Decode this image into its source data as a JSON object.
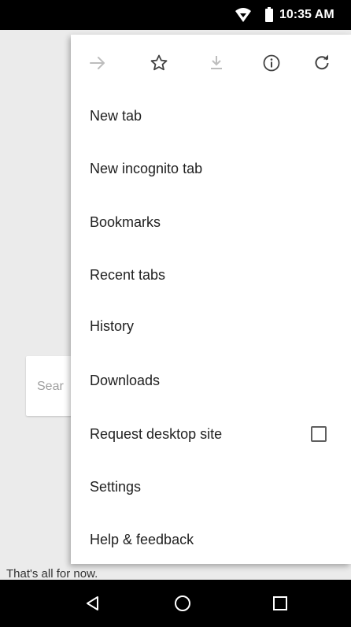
{
  "status_bar": {
    "time": "10:35 AM",
    "icons": [
      "wifi-icon",
      "battery-icon"
    ]
  },
  "page": {
    "search_placeholder": "Sear",
    "footer_text": "That's all for now."
  },
  "menu": {
    "toolbar": [
      {
        "name": "forward-icon",
        "enabled": false
      },
      {
        "name": "bookmark-star-icon",
        "enabled": true
      },
      {
        "name": "download-page-icon",
        "enabled": false
      },
      {
        "name": "page-info-icon",
        "enabled": true
      },
      {
        "name": "reload-icon",
        "enabled": true
      }
    ],
    "items": [
      {
        "label": "New tab"
      },
      {
        "label": "New incognito tab"
      },
      {
        "label": "Bookmarks"
      },
      {
        "label": "Recent tabs"
      },
      {
        "label": "History"
      },
      {
        "label": "Downloads"
      },
      {
        "label": "Request desktop site",
        "checkbox": false
      },
      {
        "label": "Settings"
      },
      {
        "label": "Help & feedback"
      }
    ]
  },
  "nav_bar": {
    "buttons": [
      "back-icon",
      "home-icon",
      "recents-icon"
    ]
  },
  "colors": {
    "status_bar": "#000000",
    "menu_background": "#ffffff",
    "menu_text": "#212121",
    "disabled_icon": "#bdbdbd",
    "enabled_icon": "#424242"
  }
}
